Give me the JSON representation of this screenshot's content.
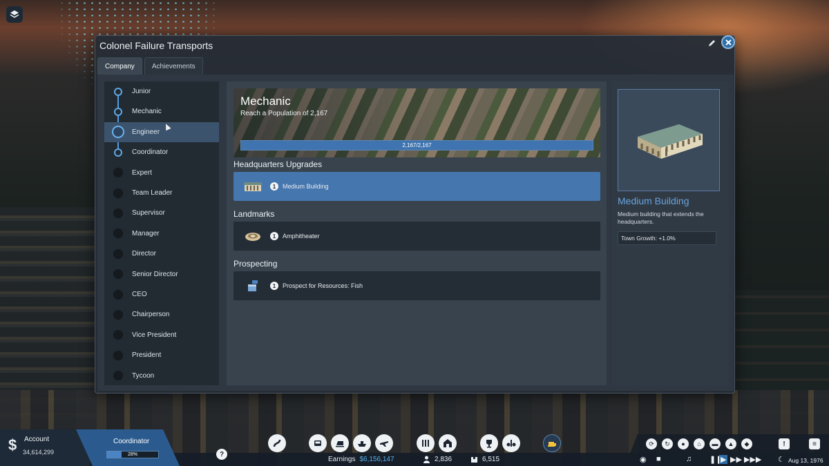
{
  "window": {
    "title": "Colonel Failure Transports"
  },
  "tabs": [
    {
      "label": "Company",
      "active": true
    },
    {
      "label": "Achievements",
      "active": false
    }
  ],
  "ranks": [
    {
      "label": "Junior",
      "state": "done"
    },
    {
      "label": "Mechanic",
      "state": "done"
    },
    {
      "label": "Engineer",
      "state": "current"
    },
    {
      "label": "Coordinator",
      "state": "done"
    },
    {
      "label": "Expert",
      "state": "locked"
    },
    {
      "label": "Team Leader",
      "state": "locked"
    },
    {
      "label": "Supervisor",
      "state": "locked"
    },
    {
      "label": "Manager",
      "state": "locked"
    },
    {
      "label": "Director",
      "state": "locked"
    },
    {
      "label": "Senior Director",
      "state": "locked"
    },
    {
      "label": "CEO",
      "state": "locked"
    },
    {
      "label": "Chairperson",
      "state": "locked"
    },
    {
      "label": "Vice President",
      "state": "locked"
    },
    {
      "label": "President",
      "state": "locked"
    },
    {
      "label": "Tycoon",
      "state": "locked"
    }
  ],
  "banner": {
    "title": "Mechanic",
    "subtitle": "Reach a Population of 2,167",
    "progress_text": "2,167/2,167",
    "progress_fraction": 1.0
  },
  "sections": {
    "hq": {
      "title": "Headquarters Upgrades",
      "items": [
        {
          "count": "1",
          "label": "Medium Building",
          "icon": "building-icon"
        }
      ]
    },
    "landmarks": {
      "title": "Landmarks",
      "items": [
        {
          "count": "1",
          "label": "Amphitheater",
          "icon": "amphitheater-icon"
        }
      ]
    },
    "prospecting": {
      "title": "Prospecting",
      "items": [
        {
          "count": "1",
          "label": "Prospect for Resources: Fish",
          "icon": "fish-crate-icon"
        }
      ]
    }
  },
  "detail": {
    "title": "Medium Building",
    "description": "Medium building that extends the headquarters.",
    "stat": "Town Growth: +1.0%"
  },
  "hud": {
    "account_label": "Account",
    "account_value": "34,614,299",
    "rank_label": "Coordinator",
    "rank_progress_text": "28%",
    "rank_progress_fraction": 0.28,
    "help": "?",
    "earnings_label": "Earnings",
    "earnings_value": "$6,156,147",
    "population": "2,836",
    "cargo": "6,515",
    "date": "Aug 13, 1976"
  },
  "colors": {
    "accent": "#4576ae",
    "detail_title": "#6aa3dc",
    "money": "#58b0f0"
  }
}
